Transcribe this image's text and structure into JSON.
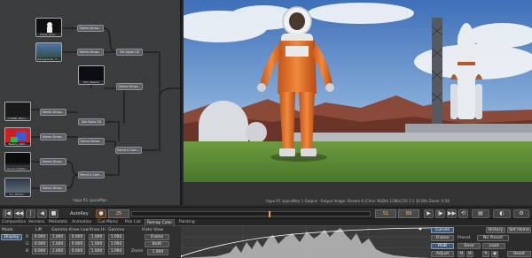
{
  "node_graph": {
    "caption": "hope P.1 spaceMan",
    "nodes": {
      "thumb_top": "Alpha_Spac...",
      "thumb_second": "Background_m...",
      "n1": "Stereo Dmso...",
      "n2": "Stereo Dmso...",
      "set_alpha_1": "Set Alpha CD",
      "n3": "Stereo Dmso...",
      "thumb_solo": "Solo_Beauty",
      "n4": "Stereo Dmso...",
      "set_alpha_2": "Set Alpha CD",
      "thumb_3": "Gr3DBt_Beau...",
      "thumb_4": "Beauty_Refl...",
      "thumb_5": "Ground_Reflec...",
      "thumb_6": "Src_Refrac...",
      "n5": "Stereo Dmso...",
      "n6": "Stereo Dmso...",
      "n7": "Stereo Dmso...",
      "n8": "Stereo Dmso...",
      "blend_1": "Blend & Com...",
      "blend_2": "Blend & Com..."
    }
  },
  "viewer": {
    "info": "hope P.1 spaceMan 1 Output - Output Image: Stream 0 (Chns: RGBA) 1280x720 1:1 16 Bits Zoom: 0.56"
  },
  "transport": {
    "autokey": "AutoKey",
    "start_frame": "25",
    "current_frame": "51",
    "end_frame": "89",
    "buttons": [
      "|◀",
      "◀◀",
      "|",
      "◀",
      "■",
      "▶",
      "|▶",
      "▶▶",
      "⟲"
    ]
  },
  "bottom": {
    "tabs": [
      "Composition",
      "Versions",
      "Metadata",
      "Animation",
      "Cue Marks",
      "Pick List",
      "Remap Color",
      "Painting"
    ],
    "active_tab": "Remap Color",
    "left": {
      "mode_label": "Mode",
      "mode_value": "Display",
      "col_headers": [
        "Lift",
        "Gamma",
        "Knee Low",
        "Knee Hi",
        "Gamma"
      ],
      "rows": [
        {
          "ch": "R",
          "vals": [
            "0.000",
            "1.000",
            "0.000",
            "1.000",
            "1.000"
          ]
        },
        {
          "ch": "G",
          "vals": [
            "0.000",
            "1.000",
            "0.000",
            "1.000",
            "1.000"
          ]
        },
        {
          "ch": "B",
          "vals": [
            "0.000",
            "1.000",
            "0.000",
            "1.000",
            "1.000"
          ]
        }
      ],
      "histo_view": "Histo View",
      "frame_btn": "Frame",
      "both_btn": "Both",
      "zoom_label": "Zoom",
      "zoom_value": "1.000"
    },
    "right": {
      "curves": "Curves",
      "history": "History",
      "set_home": "Set Home",
      "frame": "Frame",
      "preset": "Preset",
      "no_preset": "No Preset",
      "rgb": "RGB",
      "save": "Save",
      "load": "Load",
      "reset": "Reset",
      "adjust": "Adjust"
    }
  }
}
